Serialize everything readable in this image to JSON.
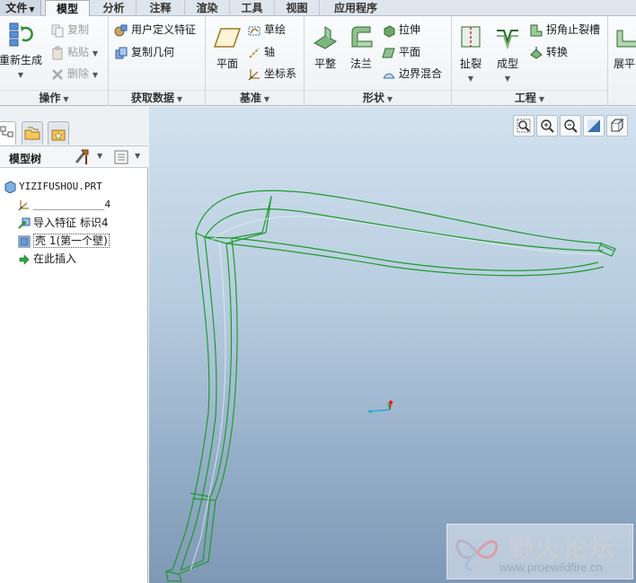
{
  "tabs": [
    {
      "label": "文件",
      "dropdown": true
    },
    {
      "label": "模型",
      "active": true
    },
    {
      "label": "分析"
    },
    {
      "label": "注释"
    },
    {
      "label": "渲染"
    },
    {
      "label": "工具"
    },
    {
      "label": "视图"
    },
    {
      "label": "应用程序"
    }
  ],
  "ribbon": {
    "operations": {
      "title": "操作",
      "regenerate": "重新生成",
      "copy": "复制",
      "paste": "粘贴",
      "delete": "删除"
    },
    "get_data": {
      "title": "获取数据",
      "user_defined_feature": "用户定义特征",
      "copy_geometry": "复制几何"
    },
    "datum": {
      "title": "基准",
      "plane": "平面",
      "sketch": "草绘",
      "axis": "轴",
      "csys": "坐标系"
    },
    "shapes": {
      "title": "形状",
      "flat": "平整",
      "flange": "法兰",
      "extrude": "拉伸",
      "planar": "平面",
      "blend": "边界混合"
    },
    "engineering": {
      "title": "工程",
      "rip": "扯裂",
      "form": "成型",
      "corner_relief": "拐角止裂槽",
      "convert": "转换"
    },
    "bend": {
      "unbend": "展平"
    }
  },
  "model_tree": {
    "header": "模型树",
    "nodes": [
      {
        "label": "YIZIFUSHOU.PRT",
        "icon": "part-icon"
      },
      {
        "label": "____________4",
        "icon": "csys-feature-icon"
      },
      {
        "label": "导入特征 标识4",
        "icon": "import-feature-icon"
      },
      {
        "label": "壳 1(第一个壁)",
        "icon": "shell-wall-icon",
        "selected": true
      },
      {
        "label": "在此插入",
        "icon": "insert-here-arrow-icon"
      }
    ]
  },
  "watermark": {
    "title": "野火论坛",
    "url": "www.proewildfire.cn"
  },
  "colors": {
    "model_edge": "#1f9a2a",
    "model_edge_light": "#b8d8b0",
    "gfx_top": "#d3e2ee",
    "gfx_bottom": "#7f98b6"
  }
}
